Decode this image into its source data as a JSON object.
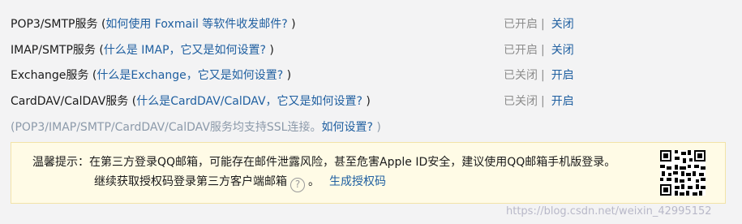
{
  "services": [
    {
      "name": "POP3/SMTP服务",
      "open_paren": " (",
      "help": "如何使用 Foxmail 等软件收发邮件?",
      "close_paren": " )",
      "state": "已开启",
      "separator": "|",
      "action": "关闭"
    },
    {
      "name": "IMAP/SMTP服务",
      "open_paren": " (",
      "help": "什么是 IMAP，它又是如何设置?",
      "close_paren": " )",
      "state": "已开启",
      "separator": "|",
      "action": "关闭"
    },
    {
      "name": "Exchange服务",
      "open_paren": " (",
      "help": "什么是Exchange，它又是如何设置?",
      "close_paren": " )",
      "state": "已关闭",
      "separator": "|",
      "action": "开启"
    },
    {
      "name": "CardDAV/CalDAV服务",
      "open_paren": " (",
      "help": "什么是CardDAV/CalDAV，它又是如何设置?",
      "close_paren": " )",
      "state": "已关闭",
      "separator": "|",
      "action": "开启"
    }
  ],
  "note": {
    "prefix": "(POP3/IMAP/SMTP/CardDAV/CalDAV服务均支持SSL连接。",
    "link": "如何设置?",
    "suffix": " )"
  },
  "notice": {
    "line1": "温馨提示：在第三方登录QQ邮箱，可能存在邮件泄露风险，甚至危害Apple ID安全，建议使用QQ邮箱手机版登录。",
    "line2": "继续获取授权码登录第三方客户端邮箱",
    "help_glyph": "?",
    "period": "。",
    "link": "生成授权码",
    "qr_icon": "qr-code-icon"
  },
  "watermark": "https://blog.csdn.net/weixin_42995152"
}
